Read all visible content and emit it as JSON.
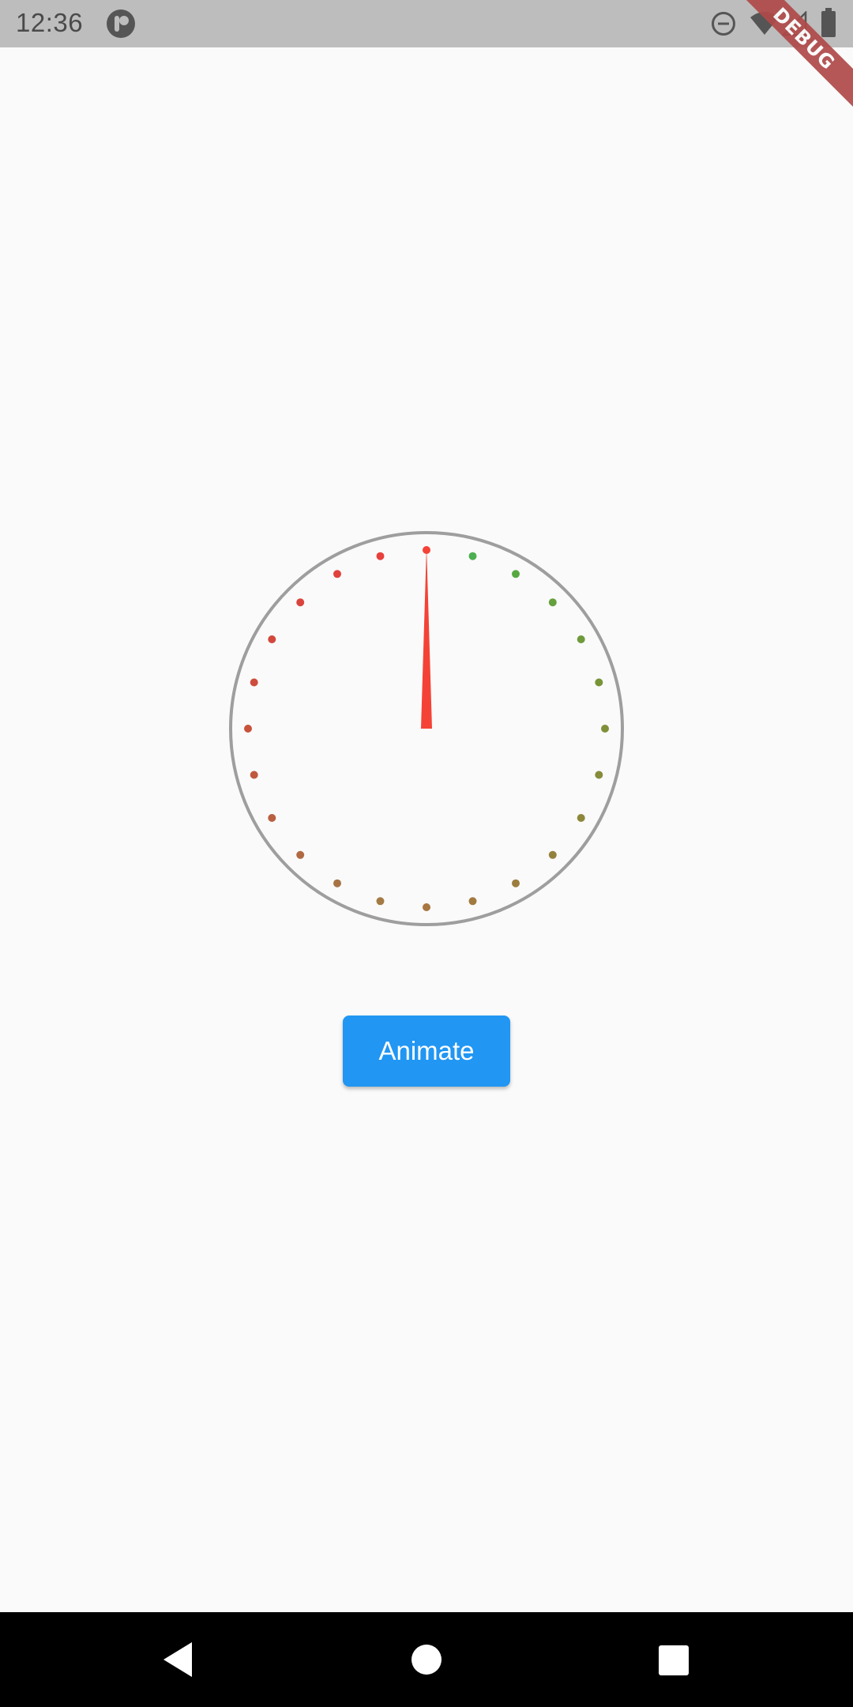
{
  "status_bar": {
    "time": "12:36",
    "icons": [
      "app-notification-icon",
      "do-not-disturb-icon",
      "wifi-icon",
      "cell-signal-icon",
      "battery-icon"
    ],
    "background": "#bdbdbd"
  },
  "debug_banner": {
    "label": "DEBUG",
    "color": "#b04a4a"
  },
  "gauge": {
    "needle_color": "#f44336",
    "ring_color": "#9e9e9e",
    "needle_value": 0,
    "dots": [
      "#f44336",
      "#4caf50",
      "#58a842",
      "#64a03c",
      "#6e9a3a",
      "#789438",
      "#7f9038",
      "#868c3a",
      "#8d873a",
      "#94823c",
      "#9c7d3e",
      "#a27a40",
      "#a87641",
      "#a47a44",
      "#a87344",
      "#b06a42",
      "#b86040",
      "#c0583e",
      "#c8523c",
      "#ce4c3c",
      "#d2483c",
      "#da443c",
      "#e0423c",
      "#e8403c"
    ]
  },
  "button": {
    "label": "Animate",
    "color": "#2196f3"
  },
  "nav_bar": {
    "buttons": [
      "back-icon",
      "home-icon",
      "recents-icon"
    ]
  }
}
